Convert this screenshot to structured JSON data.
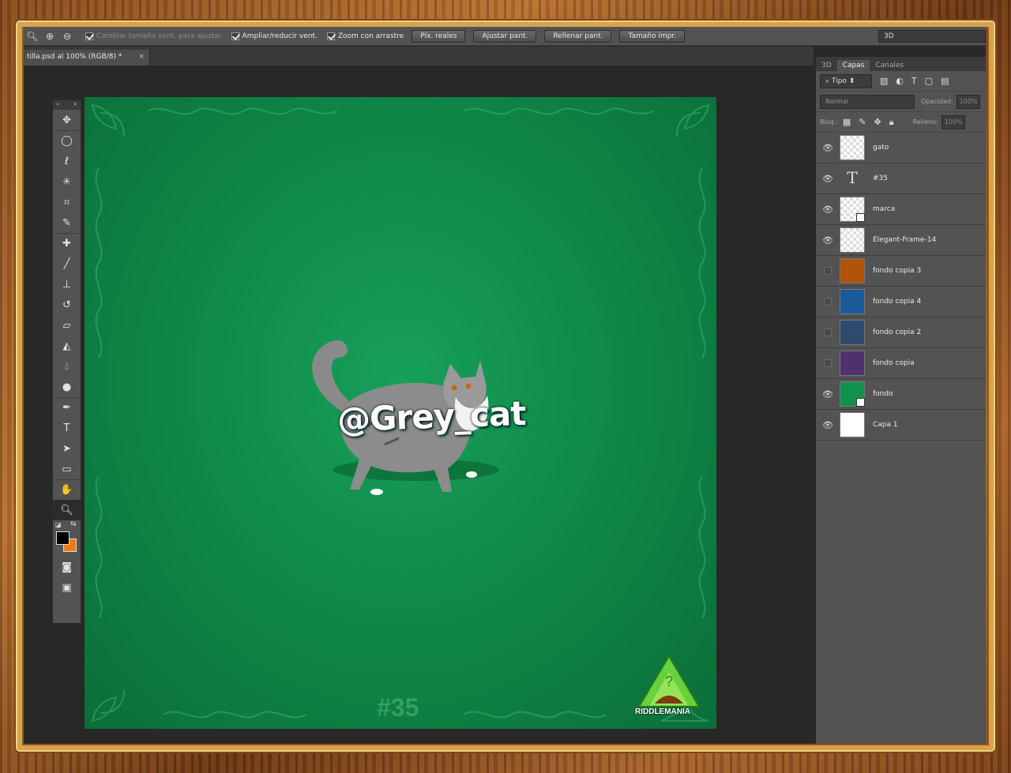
{
  "options_bar": {
    "resize_windows": "Cambiar tamaño vent. para ajustar",
    "zoom_all": "Ampliar/reducir vent.",
    "scrubby_zoom": "Zoom con arrastre",
    "actual_pixels": "Píx. reales",
    "fit_screen": "Ajustar pant.",
    "fill_screen": "Rellenar pant.",
    "print_size": "Tamaño impr.",
    "workspace": "3D"
  },
  "document": {
    "tab_title": "tilla.psd al 100% (RGB/8) *",
    "close": "×"
  },
  "canvas": {
    "watermark_text": "@Grey_cat",
    "number_text": "#35",
    "logo_label": "RIDDLEMANIA",
    "background_color": "#0f8a48"
  },
  "panel": {
    "tabs": [
      "3D",
      "Capas",
      "Canales"
    ],
    "filter_label": "Tipo",
    "blend_mode": "Normal",
    "opacity_label": "Opacidad:",
    "opacity_value": "100%",
    "lock_label": "Bloq.:",
    "fill_label": "Relleno:",
    "fill_value": "100%"
  },
  "layers": [
    {
      "name": "gato",
      "visible": true,
      "kind": "pixel",
      "color": ""
    },
    {
      "name": "#35",
      "visible": true,
      "kind": "text",
      "color": ""
    },
    {
      "name": "marca",
      "visible": true,
      "kind": "smart",
      "color": ""
    },
    {
      "name": "Elegant-Frame-14",
      "visible": true,
      "kind": "pixel",
      "color": ""
    },
    {
      "name": "fondo copia 3",
      "visible": false,
      "kind": "fill",
      "color": "#b3520a"
    },
    {
      "name": "fondo copia 4",
      "visible": false,
      "kind": "fill",
      "color": "#1b5a9a"
    },
    {
      "name": "fondo copia 2",
      "visible": false,
      "kind": "fill",
      "color": "#2e4a6e"
    },
    {
      "name": "fondo copia",
      "visible": false,
      "kind": "fill",
      "color": "#4e3270"
    },
    {
      "name": "fondo",
      "visible": true,
      "kind": "smartfill",
      "color": "#11924c"
    },
    {
      "name": "Capa 1",
      "visible": true,
      "kind": "fill",
      "color": "#ffffff"
    }
  ],
  "colors": {
    "foreground": "#000000",
    "background": "#f07a10"
  }
}
